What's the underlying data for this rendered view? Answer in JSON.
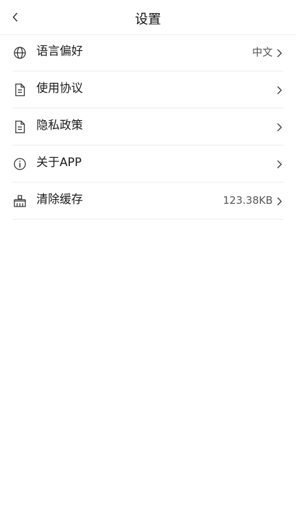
{
  "header": {
    "title": "设置"
  },
  "settings": {
    "items": [
      {
        "label": "语言偏好",
        "value": "中文",
        "icon": "globe-icon"
      },
      {
        "label": "使用协议",
        "value": "",
        "icon": "document-icon"
      },
      {
        "label": "隐私政策",
        "value": "",
        "icon": "document-icon"
      },
      {
        "label": "关于APP",
        "value": "",
        "icon": "info-icon"
      },
      {
        "label": "清除缓存",
        "value": "123.38KB",
        "icon": "broom-icon"
      }
    ]
  },
  "colors": {
    "text": "#1a1a1a",
    "muted": "#555555",
    "divider": "#ececec",
    "background": "#ffffff"
  }
}
